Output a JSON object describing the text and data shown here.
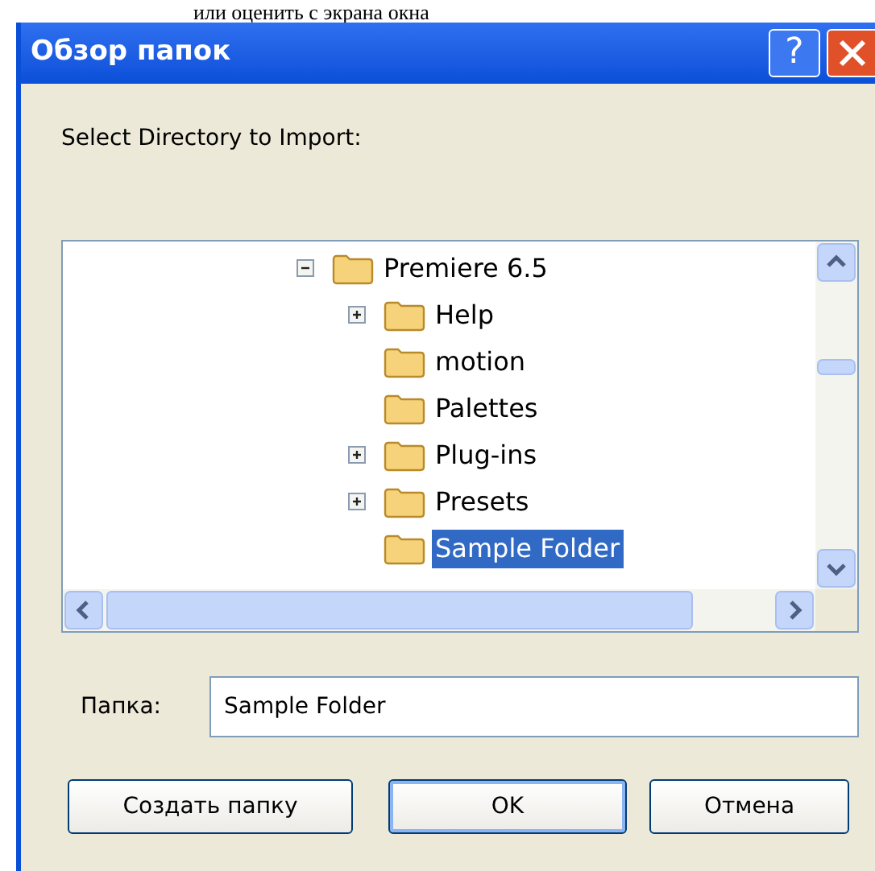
{
  "document_text": "или оценить с экрана окна",
  "window": {
    "title": "Обзор папок",
    "help": "?"
  },
  "prompt": "Select Directory to Import:",
  "tree": [
    {
      "label": "Premiere 6.5",
      "expanded": true,
      "selected": false,
      "children": [
        {
          "label": "Help",
          "expanded": false,
          "selected": false
        },
        {
          "label": "motion",
          "selected": false
        },
        {
          "label": "Palettes",
          "selected": false
        },
        {
          "label": "Plug-ins",
          "expanded": false,
          "selected": false
        },
        {
          "label": "Presets",
          "expanded": false,
          "selected": false
        },
        {
          "label": "Sample Folder",
          "selected": true
        }
      ]
    }
  ],
  "folder_field": {
    "label": "Папка:",
    "value": "Sample Folder"
  },
  "buttons": [
    {
      "label": "Создать папку",
      "default": false
    },
    {
      "label": "OK",
      "default": true
    },
    {
      "label": "Отмена",
      "default": false
    }
  ]
}
